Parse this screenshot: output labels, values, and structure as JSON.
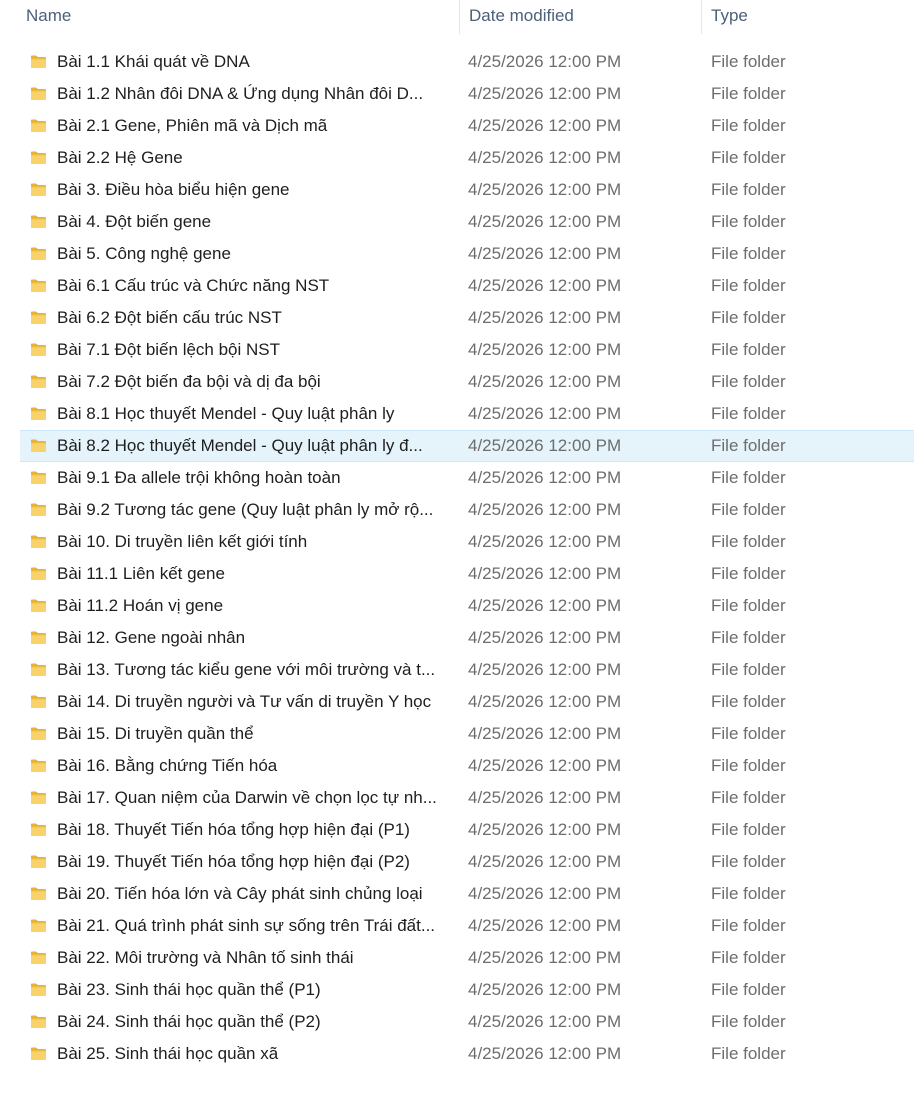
{
  "columns": {
    "name": "Name",
    "date_modified": "Date modified",
    "type": "Type"
  },
  "selected_index": 12,
  "icon": "folder-icon",
  "rows": [
    {
      "name": "Bài 1.1 Khái quát về DNA",
      "date": "4/25/2026 12:00 PM",
      "type": "File folder"
    },
    {
      "name": "Bài 1.2 Nhân đôi DNA & Ứng dụng Nhân đôi D...",
      "date": "4/25/2026 12:00 PM",
      "type": "File folder"
    },
    {
      "name": "Bài 2.1 Gene, Phiên mã và Dịch mã",
      "date": "4/25/2026 12:00 PM",
      "type": "File folder"
    },
    {
      "name": "Bài 2.2 Hệ Gene",
      "date": "4/25/2026 12:00 PM",
      "type": "File folder"
    },
    {
      "name": "Bài 3. Điều hòa biểu hiện gene",
      "date": "4/25/2026 12:00 PM",
      "type": "File folder"
    },
    {
      "name": "Bài 4. Đột biến gene",
      "date": "4/25/2026 12:00 PM",
      "type": "File folder"
    },
    {
      "name": "Bài 5. Công nghệ gene",
      "date": "4/25/2026 12:00 PM",
      "type": "File folder"
    },
    {
      "name": "Bài 6.1 Cấu trúc và Chức năng NST",
      "date": "4/25/2026 12:00 PM",
      "type": "File folder"
    },
    {
      "name": "Bài 6.2 Đột biến cấu trúc NST",
      "date": "4/25/2026 12:00 PM",
      "type": "File folder"
    },
    {
      "name": "Bài 7.1 Đột biến lệch bội NST",
      "date": "4/25/2026 12:00 PM",
      "type": "File folder"
    },
    {
      "name": "Bài 7.2 Đột biến đa bội và dị đa bội",
      "date": "4/25/2026 12:00 PM",
      "type": "File folder"
    },
    {
      "name": "Bài 8.1 Học thuyết Mendel - Quy luật phân ly",
      "date": "4/25/2026 12:00 PM",
      "type": "File folder"
    },
    {
      "name": "Bài 8.2 Học thuyết Mendel - Quy luật phân ly đ...",
      "date": "4/25/2026 12:00 PM",
      "type": "File folder"
    },
    {
      "name": "Bài 9.1 Đa allele trội không hoàn toàn",
      "date": "4/25/2026 12:00 PM",
      "type": "File folder"
    },
    {
      "name": "Bài 9.2 Tương tác gene (Quy luật phân ly mở rộ...",
      "date": "4/25/2026 12:00 PM",
      "type": "File folder"
    },
    {
      "name": "Bài 10. Di truyền liên kết giới tính",
      "date": "4/25/2026 12:00 PM",
      "type": "File folder"
    },
    {
      "name": "Bài 11.1 Liên kết gene",
      "date": "4/25/2026 12:00 PM",
      "type": "File folder"
    },
    {
      "name": "Bài 11.2 Hoán vị gene",
      "date": "4/25/2026 12:00 PM",
      "type": "File folder"
    },
    {
      "name": "Bài 12. Gene ngoài nhân",
      "date": "4/25/2026 12:00 PM",
      "type": "File folder"
    },
    {
      "name": "Bài 13. Tương tác kiểu gene với môi trường và t...",
      "date": "4/25/2026 12:00 PM",
      "type": "File folder"
    },
    {
      "name": "Bài 14. Di truyền người và Tư vấn di truyền Y học",
      "date": "4/25/2026 12:00 PM",
      "type": "File folder"
    },
    {
      "name": "Bài 15. Di truyền quần thể",
      "date": "4/25/2026 12:00 PM",
      "type": "File folder"
    },
    {
      "name": "Bài 16. Bằng chứng Tiến hóa",
      "date": "4/25/2026 12:00 PM",
      "type": "File folder"
    },
    {
      "name": "Bài 17. Quan niệm của Darwin về chọn lọc tự nh...",
      "date": "4/25/2026 12:00 PM",
      "type": "File folder"
    },
    {
      "name": "Bài 18. Thuyết Tiến hóa tổng hợp hiện đại (P1)",
      "date": "4/25/2026 12:00 PM",
      "type": "File folder"
    },
    {
      "name": "Bài 19. Thuyết Tiến hóa tổng hợp hiện đại (P2)",
      "date": "4/25/2026 12:00 PM",
      "type": "File folder"
    },
    {
      "name": "Bài 20. Tiến hóa lớn và Cây phát sinh chủng loại",
      "date": "4/25/2026 12:00 PM",
      "type": "File folder"
    },
    {
      "name": "Bài 21. Quá trình phát sinh sự sống trên Trái đất...",
      "date": "4/25/2026 12:00 PM",
      "type": "File folder"
    },
    {
      "name": "Bài 22. Môi trường và Nhân tố sinh thái",
      "date": "4/25/2026 12:00 PM",
      "type": "File folder"
    },
    {
      "name": "Bài 23. Sinh thái học quần thể (P1)",
      "date": "4/25/2026 12:00 PM",
      "type": "File folder"
    },
    {
      "name": "Bài 24. Sinh thái học quần thể (P2)",
      "date": "4/25/2026 12:00 PM",
      "type": "File folder"
    },
    {
      "name": "Bài 25. Sinh thái học quần xã",
      "date": "4/25/2026 12:00 PM",
      "type": "File folder"
    }
  ]
}
